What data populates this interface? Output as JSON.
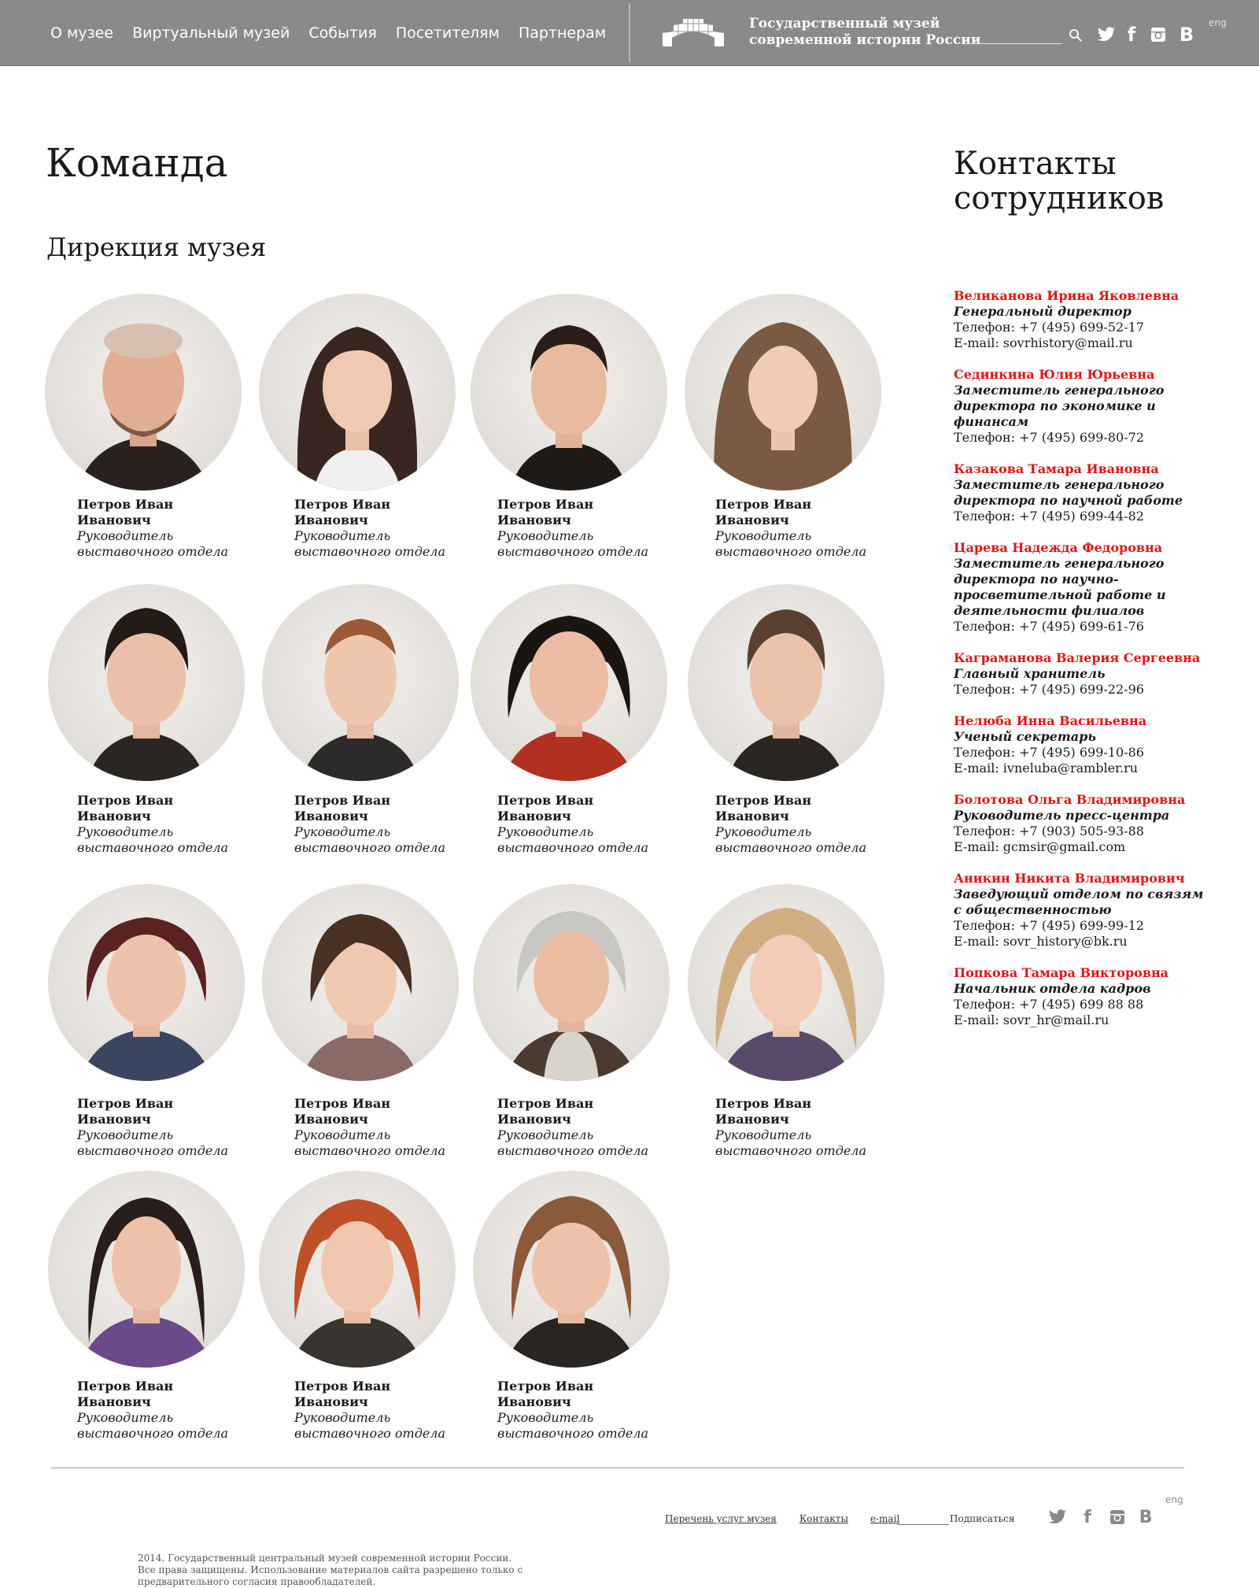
{
  "header": {
    "nav": [
      "О музее",
      "Виртуальный музей",
      "События",
      "Посетителям",
      "Партнерам"
    ],
    "museum_name_line1": "Государственный музей",
    "museum_name_line2": "современной истории России",
    "lang": "eng",
    "icons": [
      "search-icon",
      "twitter-icon",
      "facebook-icon",
      "instagram-icon",
      "vk-icon"
    ],
    "bg_color": "#8a8a8a"
  },
  "main": {
    "title": "Команда",
    "section": "Дирекция музея",
    "people": [
      {
        "name": "Петров Иван Иванович",
        "role": "Руководитель выставочного отдела"
      },
      {
        "name": "Петров Иван Иванович",
        "role": "Руководитель выставочного отдела"
      },
      {
        "name": "Петров Иван Иванович",
        "role": "Руководитель выставочного отдела"
      },
      {
        "name": "Петров Иван Иванович",
        "role": "Руководитель выставочного отдела"
      },
      {
        "name": "Петров Иван Иванович",
        "role": "Руководитель выставочного отдела"
      },
      {
        "name": "Петров Иван Иванович",
        "role": "Руководитель выставочного отдела"
      },
      {
        "name": "Петров Иван Иванович",
        "role": "Руководитель выставочного отдела"
      },
      {
        "name": "Петров Иван Иванович",
        "role": "Руководитель выставочного отдела"
      },
      {
        "name": "Петров Иван Иванович",
        "role": "Руководитель выставочного отдела"
      },
      {
        "name": "Петров Иван Иванович",
        "role": "Руководитель выставочного отдела"
      },
      {
        "name": "Петров Иван Иванович",
        "role": "Руководитель выставочного отдела"
      },
      {
        "name": "Петров Иван Иванович",
        "role": "Руководитель выставочного отдела"
      },
      {
        "name": "Петров Иван Иванович",
        "role": "Руководитель выставочного отдела"
      },
      {
        "name": "Петров Иван Иванович",
        "role": "Руководитель выставочного отдела"
      },
      {
        "name": "Петров Иван Иванович",
        "role": "Руководитель выставочного отдела"
      }
    ]
  },
  "contacts": {
    "title": "Контакты сотрудников",
    "accent_color": "#e01515",
    "items": [
      {
        "name": "Великанова Ирина Яковлевна",
        "role": "Генеральный директор",
        "phone": "Телефон: +7 (495) 699-52-17",
        "email": "E-mail: sovrhistory@mail.ru"
      },
      {
        "name": "Сединкина Юлия Юрьевна",
        "role": "Заместитель генерального директора по экономике и финансам",
        "phone": "Телефон: +7 (495) 699-80-72",
        "email": ""
      },
      {
        "name": "Казакова Тамара Ивановна",
        "role": "Заместитель генерального директора по научной работе",
        "phone": "Телефон: +7 (495) 699-44-82",
        "email": ""
      },
      {
        "name": "Царева Надежда Федоровна",
        "role": "Заместитель генерального директора по научно-просветительной работе и деятельности филиалов",
        "phone": "Телефон: +7 (495) 699-61-76",
        "email": ""
      },
      {
        "name": "Каграманова Валерия Сергеевна",
        "role": "Главный хранитель",
        "phone": "Телефон: +7 (495) 699-22-96",
        "email": ""
      },
      {
        "name": "Нелюба Инна Васильевна",
        "role": "Ученый секретарь",
        "phone": "Телефон: +7 (495) 699-10-86",
        "email": "E-mail: ivneluba@rambler.ru"
      },
      {
        "name": "Болотова Ольга Владимировна",
        "role": "Руководитель пресс-центра",
        "phone": "Телефон: +7 (903) 505-93-88",
        "email": "E-mail: gcmsir@gmail.com"
      },
      {
        "name": "Аникин Никита Владимирович",
        "role": "Заведующий отделом по связям с общественностью",
        "phone": "Телефон: +7 (495) 699-99-12",
        "email": "E-mail: sovr_history@bk.ru"
      },
      {
        "name": "Попкова Тамара Викторовна",
        "role": "Начальник отдела кадров",
        "phone": "Телефон: +7 (495) 699 88 88",
        "email": "E-mail: sovr_hr@mail.ru"
      }
    ]
  },
  "footer": {
    "services": "Перечень услуг музея",
    "contacts": "Контакты",
    "email_label": "e-mail",
    "subscribe": "Подписаться",
    "lang": "eng",
    "copyright_line1": "2014. Государственный центральный музей современной истории России.",
    "copyright_line2": "Все права защищены. Использование материалов сайта разрешено только с",
    "copyright_line3": "предварительного согласия правообладателей."
  }
}
